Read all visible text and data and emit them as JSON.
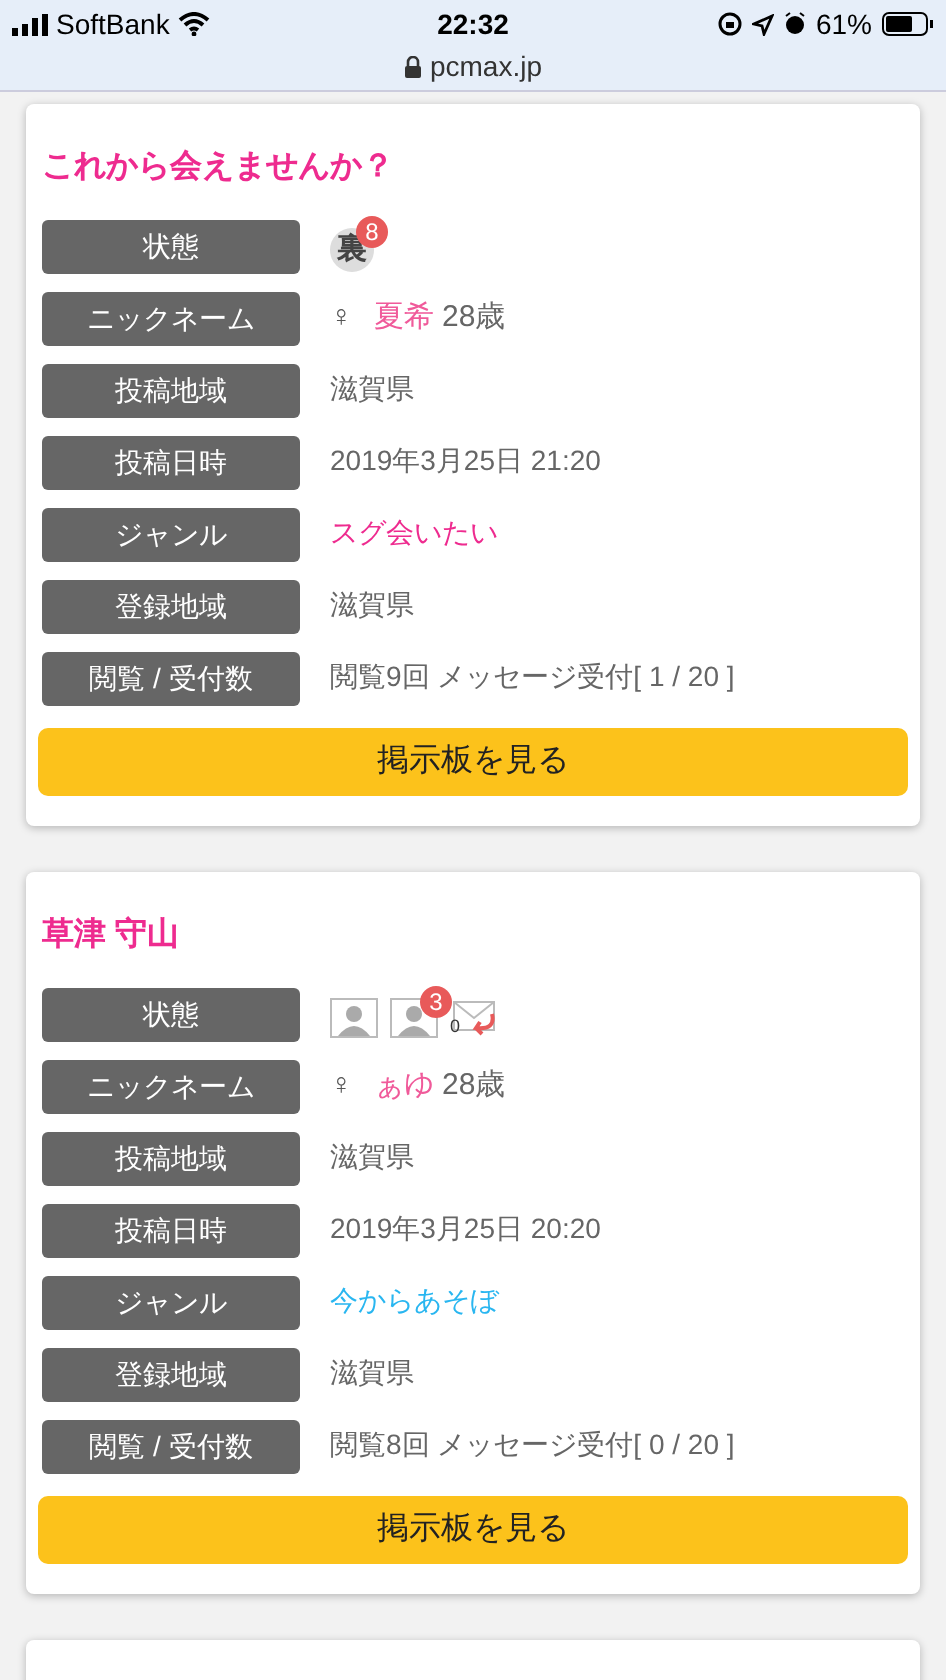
{
  "status_bar": {
    "carrier": "SoftBank",
    "time": "22:32",
    "battery": "61%"
  },
  "address_bar": {
    "url": "pcmax.jp"
  },
  "posts": [
    {
      "title": "これから会えませんか？",
      "rows": [
        {
          "kind": "status",
          "label": "状態",
          "icons": [
            {
              "kind": "ura",
              "text": "裏",
              "count": "8"
            }
          ]
        },
        {
          "kind": "nickname",
          "label": "ニックネーム",
          "gender": "♀",
          "name": "夏希",
          "age": "28歳"
        },
        {
          "kind": "text",
          "label": "投稿地域",
          "value": "滋賀県"
        },
        {
          "kind": "text",
          "label": "投稿日時",
          "value": "2019年3月25日 21:20"
        },
        {
          "kind": "genre",
          "label": "ジャンル",
          "value": "スグ会いたい",
          "color": "#ee2b8f"
        },
        {
          "kind": "text",
          "label": "登録地域",
          "value": "滋賀県"
        },
        {
          "kind": "text",
          "label": "閲覧 / 受付数",
          "value": "閲覧9回 メッセージ受付[ 1 / 20 ]"
        }
      ],
      "button": "掲示板を見る"
    },
    {
      "title": "草津 守山",
      "rows": [
        {
          "kind": "status",
          "label": "状態",
          "icons": [
            {
              "kind": "photo"
            },
            {
              "kind": "album",
              "count": "3"
            },
            {
              "kind": "mail",
              "count": "0"
            }
          ]
        },
        {
          "kind": "nickname",
          "label": "ニックネーム",
          "gender": "♀",
          "name": "ぁゆ",
          "age": "28歳"
        },
        {
          "kind": "text",
          "label": "投稿地域",
          "value": "滋賀県"
        },
        {
          "kind": "text",
          "label": "投稿日時",
          "value": "2019年3月25日 20:20"
        },
        {
          "kind": "genre",
          "label": "ジャンル",
          "value": "今からあそぼ",
          "color": "#29b6f0"
        },
        {
          "kind": "text",
          "label": "登録地域",
          "value": "滋賀県"
        },
        {
          "kind": "text",
          "label": "閲覧 / 受付数",
          "value": "閲覧8回 メッセージ受付[ 0 / 20 ]"
        }
      ],
      "button": "掲示板を見る"
    }
  ]
}
